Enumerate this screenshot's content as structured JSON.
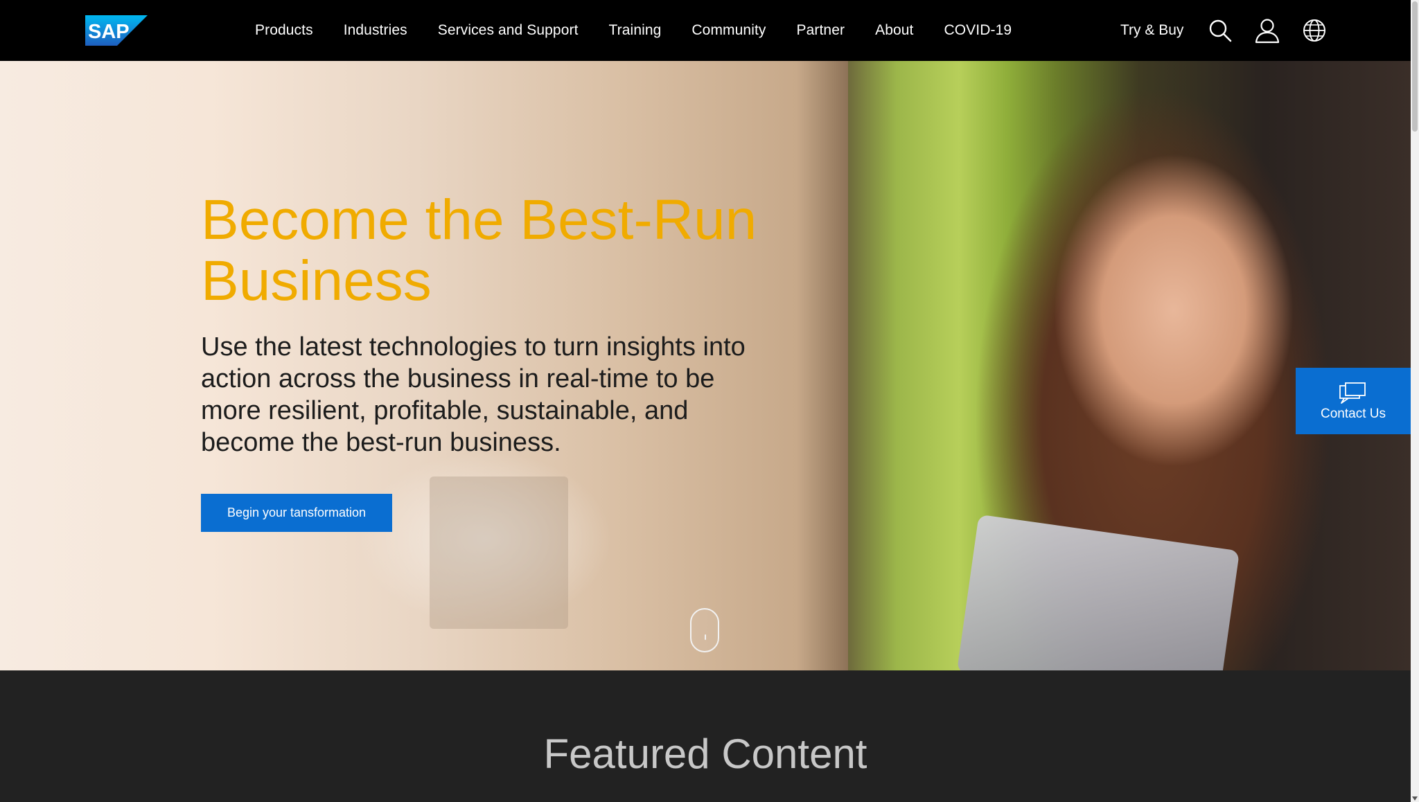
{
  "header": {
    "logo_text": "SAP",
    "nav_items": [
      {
        "label": "Products"
      },
      {
        "label": "Industries"
      },
      {
        "label": "Services and Support"
      },
      {
        "label": "Training"
      },
      {
        "label": "Community"
      },
      {
        "label": "Partner"
      },
      {
        "label": "About"
      },
      {
        "label": "COVID-19"
      }
    ],
    "try_buy_label": "Try & Buy",
    "icons": [
      "search-icon",
      "user-icon",
      "globe-icon"
    ]
  },
  "hero": {
    "title": "Become the Best-Run Business",
    "subtitle": "Use the latest technologies to turn insights into action across the business in real-time to be more resilient, profitable, sustainable, and become the best-run business.",
    "cta_label": "Begin your tansformation"
  },
  "contact": {
    "label": "Contact Us",
    "icon": "chat-icon"
  },
  "featured": {
    "title": "Featured Content"
  },
  "colors": {
    "nav_background": "#000000",
    "accent_gold": "#f0ab00",
    "primary_blue": "#0a6ed1",
    "featured_background": "#222222"
  }
}
